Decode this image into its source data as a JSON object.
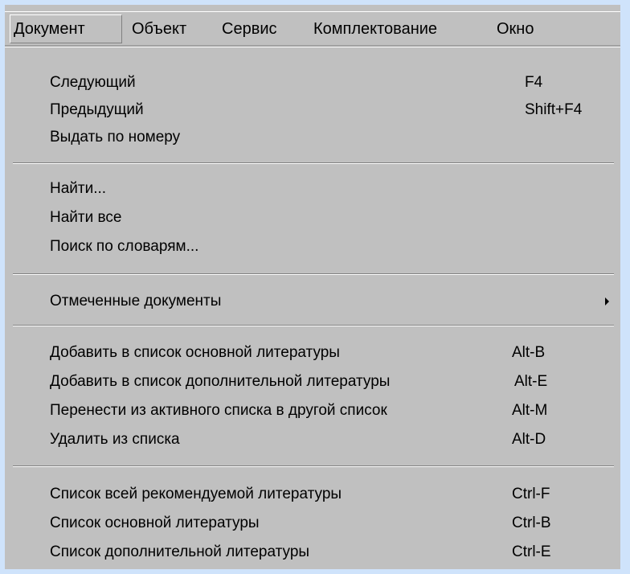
{
  "menubar": {
    "items": [
      "Документ",
      "Объект",
      "Сервис",
      "Комплектование",
      "Окно"
    ],
    "active_index": 0
  },
  "menu": {
    "items": [
      {
        "label": "Следующий",
        "shortcut": "F4"
      },
      {
        "label": "Предыдущий",
        "shortcut": "Shift+F4"
      },
      {
        "label": "Выдать по номеру",
        "shortcut": ""
      },
      {
        "label": "Найти...",
        "shortcut": ""
      },
      {
        "label": "Найти все",
        "shortcut": ""
      },
      {
        "label": "Поиск по словарям...",
        "shortcut": ""
      },
      {
        "label": "Отмеченные документы",
        "shortcut": "",
        "submenu": true
      },
      {
        "label": "Добавить в список основной литературы",
        "shortcut": "Alt-B"
      },
      {
        "label": "Добавить в список дополнительной литературы",
        "shortcut": "Alt-E"
      },
      {
        "label": "Перенести из активного списка в другой список",
        "shortcut": "Alt-M"
      },
      {
        "label": "Удалить из списка",
        "shortcut": "Alt-D"
      },
      {
        "label": "Список всей рекомендуемой литературы",
        "shortcut": "Ctrl-F"
      },
      {
        "label": "Список основной литературы",
        "shortcut": "Ctrl-B"
      },
      {
        "label": "Список дополнительной литературы",
        "shortcut": "Ctrl-E"
      }
    ]
  },
  "colors": {
    "background": "#cfe3fb",
    "menu_face": "#c0c0c0",
    "shadow": "#808080",
    "highlight": "#ffffff"
  }
}
